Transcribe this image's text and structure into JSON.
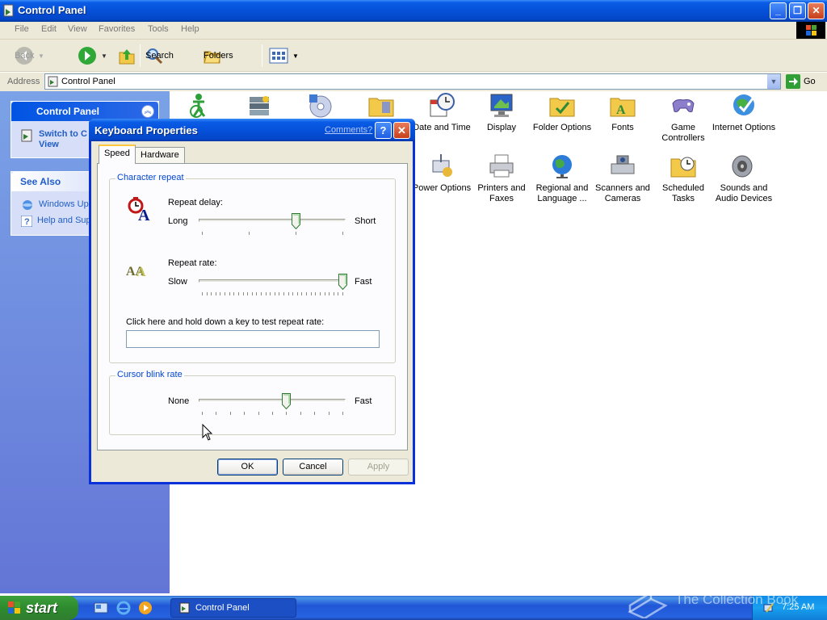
{
  "window": {
    "title": "Control Panel"
  },
  "menu": [
    "File",
    "Edit",
    "View",
    "Favorites",
    "Tools",
    "Help"
  ],
  "toolbar": {
    "back": "Back",
    "search": "Search",
    "folders": "Folders"
  },
  "address": {
    "label": "Address",
    "value": "Control Panel",
    "go": "Go"
  },
  "taskpane": {
    "control_panel": {
      "title": "Control Panel",
      "link": "Switch to C",
      "link2": "View"
    },
    "see_also": {
      "title": "See Also",
      "links": [
        "Windows Upd",
        "Help and Sup"
      ]
    }
  },
  "icons": [
    {
      "label": "",
      "icon": "accessibility-icon"
    },
    {
      "label": "",
      "icon": "add-remove-programs-icon"
    },
    {
      "label": "",
      "icon": "add-hardware-icon"
    },
    {
      "label": "",
      "icon": "administrative-tools-icon"
    },
    {
      "label": "Date and Time",
      "icon": "date-time-icon"
    },
    {
      "label": "Display",
      "icon": "display-icon"
    },
    {
      "label": "Folder Options",
      "icon": "folder-options-icon"
    },
    {
      "label": "Fonts",
      "icon": "fonts-icon"
    },
    {
      "label": "Game Controllers",
      "icon": "game-controllers-icon"
    },
    {
      "label": "Internet Options",
      "icon": "internet-options-icon"
    },
    {
      "label": "Power Options",
      "icon": "power-options-icon"
    },
    {
      "label": "Printers and Faxes",
      "icon": "printers-faxes-icon"
    },
    {
      "label": "Regional and Language ...",
      "icon": "regional-language-icon"
    },
    {
      "label": "Scanners and Cameras",
      "icon": "scanners-cameras-icon"
    },
    {
      "label": "Scheduled Tasks",
      "icon": "scheduled-tasks-icon"
    },
    {
      "label": "Sounds and Audio Devices",
      "icon": "sounds-audio-icon"
    }
  ],
  "dialog": {
    "title": "Keyboard Properties",
    "comments": "Comments?",
    "help": "?",
    "tabs": [
      "Speed",
      "Hardware"
    ],
    "character_repeat": {
      "legend": "Character repeat",
      "delay_label": "Repeat delay:",
      "delay_min": "Long",
      "delay_max": "Short",
      "delay_value": 2,
      "delay_levels": 4,
      "rate_label": "Repeat rate:",
      "rate_min": "Slow",
      "rate_max": "Fast",
      "rate_value": 31,
      "rate_levels": 32,
      "test_label": "Click here and hold down a key to test repeat rate:",
      "test_value": ""
    },
    "cursor_blink": {
      "legend": "Cursor blink rate",
      "min": "None",
      "max": "Fast",
      "value": 6,
      "levels": 11
    },
    "buttons": {
      "ok": "OK",
      "cancel": "Cancel",
      "apply": "Apply"
    }
  },
  "taskbar": {
    "start": "start",
    "task": "Control Panel",
    "clock": "7:25 AM"
  },
  "watermark": "The Collection Book"
}
